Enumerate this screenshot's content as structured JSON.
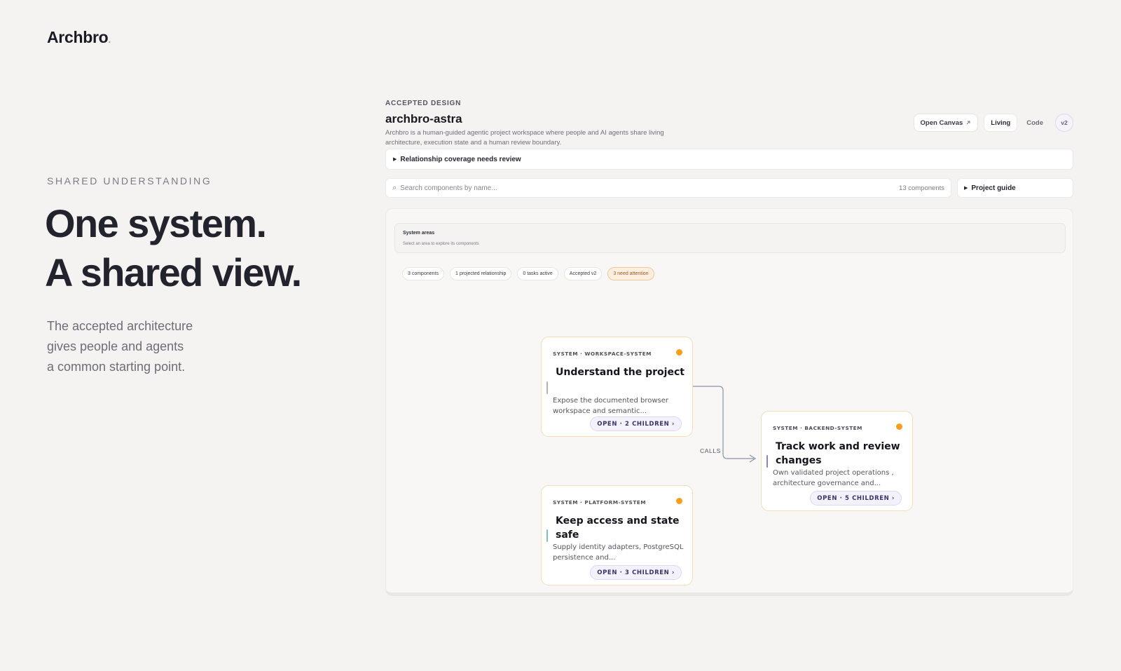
{
  "brand": {
    "name": "Archbro",
    "dot": "."
  },
  "hero": {
    "eyebrow": "SHARED UNDERSTANDING",
    "headline_line1": "One system.",
    "headline_line2": "A shared view.",
    "sub_line1": "The accepted architecture",
    "sub_line2": "gives people and agents",
    "sub_line3": "a common starting point."
  },
  "app": {
    "kicker": "ACCEPTED DESIGN",
    "title": "archbro-astra",
    "description": "Archbro is a human-guided agentic project workspace where people and AI agents share living architecture, execution state and a human review boundary.",
    "actions": {
      "open_canvas": "Open Canvas",
      "open_canvas_icon": "external-link-icon",
      "living": "Living",
      "code": "Code",
      "version": "v2"
    },
    "coverage_notice": "Relationship coverage needs review",
    "search": {
      "placeholder": "Search components by name...",
      "count": "13 components"
    },
    "project_guide": "Project guide",
    "canvas": {
      "areas_title": "System areas",
      "areas_hint": "Select an area to explore its components",
      "chips": [
        "3 components",
        "1 projected relationship",
        "0 tasks active",
        "Accepted v2",
        "3 need attention"
      ],
      "edge_label": "CALLS",
      "nodes": [
        {
          "kicker": "SYSTEM · WORKSPACE-SYSTEM",
          "title": "Understand the project",
          "description": "Expose the documented browser workspace and semantic...",
          "open": "OPEN · 2 CHILDREN ›",
          "accent": "#b7b1a8"
        },
        {
          "kicker": "SYSTEM · BACKEND-SYSTEM",
          "title": "Track work and review changes",
          "description": "Own validated project operations , architecture governance and...",
          "open": "OPEN · 5 CHILDREN ›",
          "accent": "#8c86b8"
        },
        {
          "kicker": "SYSTEM · PLATFORM-SYSTEM",
          "title": "Keep access and state safe",
          "description": "Supply identity adapters, PostgreSQL persistence and...",
          "open": "OPEN · 3 CHILDREN ›",
          "accent": "#7fbfae"
        }
      ]
    }
  },
  "colors": {
    "background": "#f5f3f1",
    "status_attention": "#f59f1a",
    "node_border": "#f3dcb8",
    "pill_text": "#3c3466"
  }
}
